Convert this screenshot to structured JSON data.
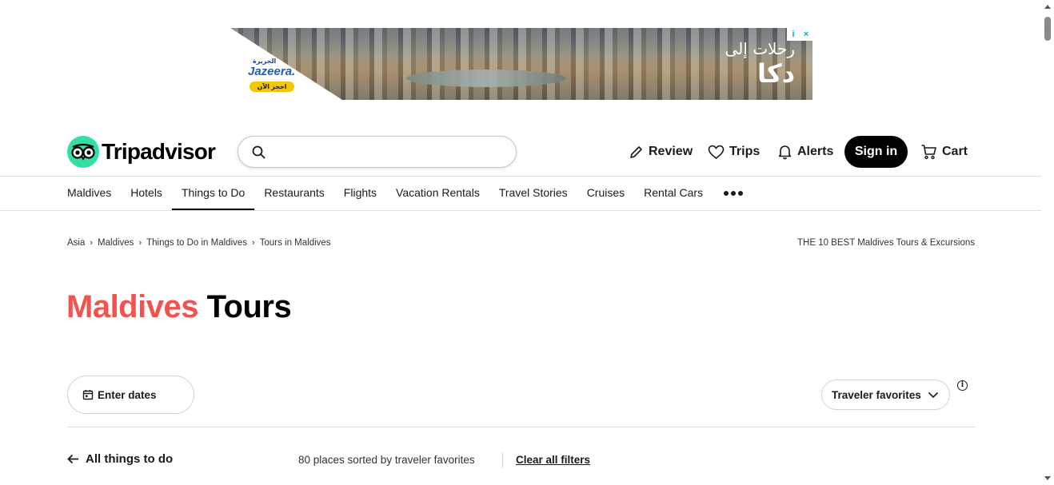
{
  "ad": {
    "brand_ar": "الجزيرة",
    "brand": "Jazeera.",
    "cta": "احجز الآن",
    "headline_ar": "رحلات إلى",
    "destination_ar": "دكا",
    "info_glyph": "i",
    "close_glyph": "×"
  },
  "header": {
    "logo_text": "Tripadvisor",
    "search_placeholder": "",
    "review_label": "Review",
    "trips_label": "Trips",
    "alerts_label": "Alerts",
    "signin_label": "Sign in",
    "cart_label": "Cart"
  },
  "tabs": [
    {
      "label": "Maldives"
    },
    {
      "label": "Hotels"
    },
    {
      "label": "Things to Do",
      "active": true
    },
    {
      "label": "Restaurants"
    },
    {
      "label": "Flights"
    },
    {
      "label": "Vacation Rentals"
    },
    {
      "label": "Travel Stories"
    },
    {
      "label": "Cruises"
    },
    {
      "label": "Rental Cars"
    }
  ],
  "breadcrumb": {
    "items": [
      "Asia",
      "Maldives",
      "Things to Do in Maldives",
      "Tours in Maldives"
    ],
    "right_text": "THE 10 BEST Maldives Tours & Excursions"
  },
  "title": {
    "location": "Maldives",
    "rest": " Tours"
  },
  "filters": {
    "dates_label": "Enter dates",
    "sort_label": "Traveler favorites",
    "info_glyph": "i"
  },
  "results": {
    "back_label": "All things to do",
    "count_text": "80 places sorted by traveler favorites",
    "clear_label": "Clear all filters"
  },
  "colors": {
    "brand_green": "#34e0a1",
    "title_accent": "#f2544d",
    "signin_bg": "#000000"
  }
}
